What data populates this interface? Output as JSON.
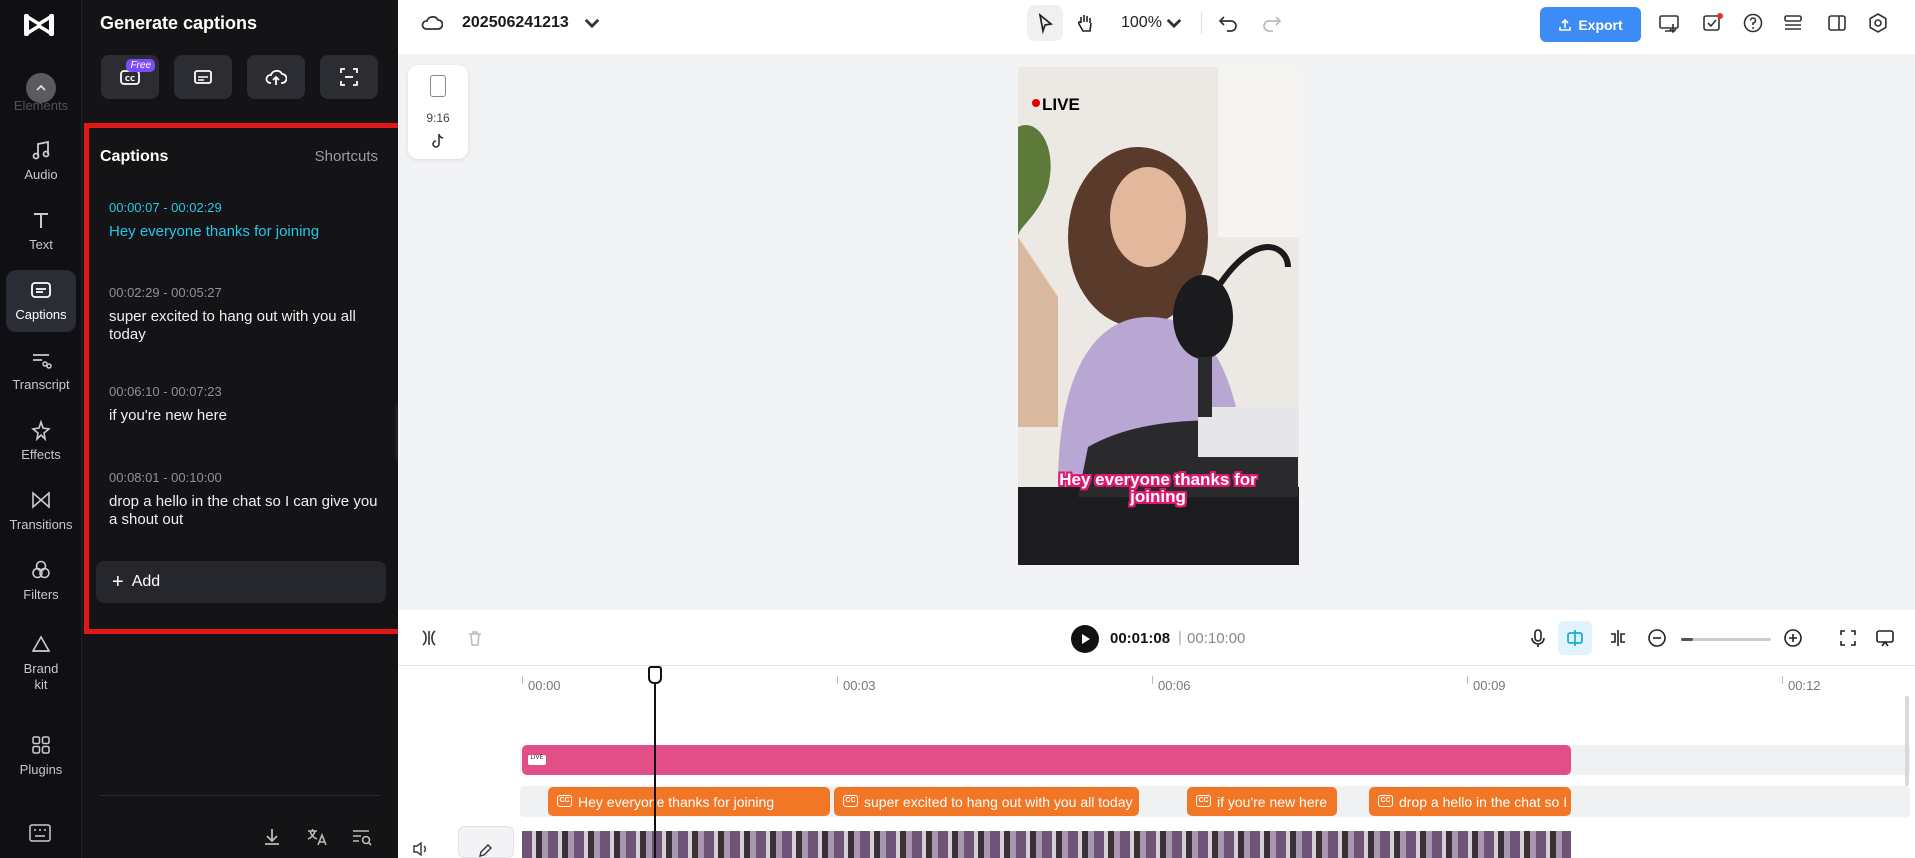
{
  "rail": {
    "items": [
      {
        "label": "Elements",
        "icon": "elements-icon"
      },
      {
        "label": "Audio",
        "icon": "music-note-icon"
      },
      {
        "label": "Text",
        "icon": "text-icon"
      },
      {
        "label": "Captions",
        "icon": "captions-icon"
      },
      {
        "label": "Transcript",
        "icon": "transcript-icon"
      },
      {
        "label": "Effects",
        "icon": "effects-sparkle-icon"
      },
      {
        "label": "Transitions",
        "icon": "transitions-icon"
      },
      {
        "label": "Filters",
        "icon": "filters-icon"
      },
      {
        "label": "Brand kit",
        "icon": "brand-kit-icon"
      },
      {
        "label": "Plugins",
        "icon": "plugins-grid-icon"
      }
    ],
    "active": "Captions"
  },
  "panel": {
    "title": "Generate captions",
    "free_badge": "Free",
    "captions_header": "Captions",
    "shortcuts_label": "Shortcuts",
    "captions": [
      {
        "time": "00:00:07 - 00:02:29",
        "text": "Hey everyone thanks for joining"
      },
      {
        "time": "00:02:29 - 00:05:27",
        "text": "super excited to hang out with you all today"
      },
      {
        "time": "00:06:10 - 00:07:23",
        "text": "if you're new here"
      },
      {
        "time": "00:08:01 - 00:10:00",
        "text": "drop a hello in the chat so I can give you a shout out"
      }
    ],
    "add_label": "Add"
  },
  "topbar": {
    "project_name": "202506241213",
    "zoom": "100%",
    "export_label": "Export"
  },
  "canvas": {
    "ratio": "9:16",
    "live_label": "LIVE",
    "video_caption": "Hey everyone thanks for joining"
  },
  "playback": {
    "current_time": "00:01:08",
    "separator": "|",
    "total_time": "00:10:00"
  },
  "timeline": {
    "ruler": [
      "00:00",
      "00:03",
      "00:06",
      "00:09",
      "00:12"
    ],
    "caption_clips": [
      "Hey everyone thanks for joining",
      "super excited to hang out with you all today",
      "if you're new here",
      "drop a hello in the chat so I"
    ],
    "clip_thumb_label": "LIVE"
  },
  "colors": {
    "accent_blue": "#3d8bf5",
    "active_caption": "#26c6e8",
    "pink_clip": "#e14f86",
    "caption_clip": "#f17727",
    "highlight_frame": "#e01818"
  }
}
